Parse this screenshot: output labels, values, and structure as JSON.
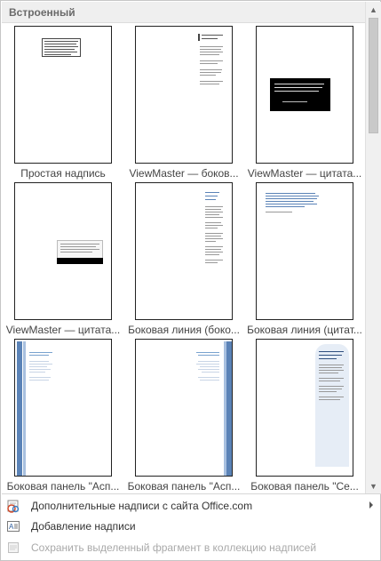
{
  "gallery": {
    "header": "Встроенный",
    "items": [
      {
        "caption": "Простая надпись"
      },
      {
        "caption": "ViewMaster — боков..."
      },
      {
        "caption": "ViewMaster — цитата..."
      },
      {
        "caption": "ViewMaster — цитата..."
      },
      {
        "caption": "Боковая линия (боко..."
      },
      {
        "caption": "Боковая линия (цитат..."
      },
      {
        "caption": "Боковая панель \"Асп..."
      },
      {
        "caption": "Боковая панель \"Асп..."
      },
      {
        "caption": "Боковая панель \"Се..."
      }
    ]
  },
  "menu": {
    "more_from_office": "Дополнительные надписи с сайта Office.com",
    "add_textbox": "Добавление надписи",
    "save_selection": "Сохранить выделенный фрагмент в коллекцию надписей"
  },
  "colors": {
    "header_bg": "#efefef",
    "accent_blue": "#5b83b7",
    "disabled_text": "#a9a9a9"
  }
}
